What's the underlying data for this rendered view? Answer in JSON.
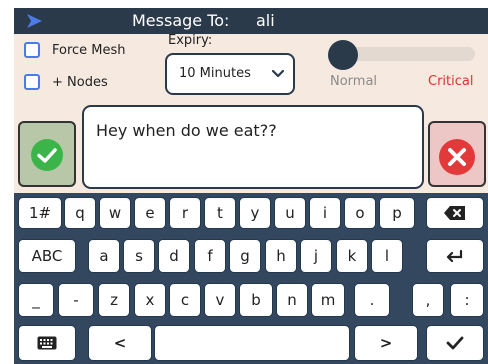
{
  "header": {
    "title_label": "Message To:",
    "recipient": "ali",
    "arrow_icon": "send-arrow-icon",
    "bg_color": "#2b3a4b",
    "arrow_color": "#4a7be8"
  },
  "options": {
    "force_mesh_label": "Force Mesh",
    "nodes_label": "+ Nodes",
    "force_mesh_checked": false,
    "nodes_checked": false,
    "expiry_label": "Expiry:",
    "expiry_value": "10 Minutes",
    "priority_low_label": "Normal",
    "priority_high_label": "Critical",
    "priority_level": 0
  },
  "compose": {
    "message_text": "Hey when do we eat??",
    "send_icon": "check-icon",
    "cancel_icon": "close-icon",
    "send_color": "#3bb54a",
    "cancel_color": "#e23a3a"
  },
  "keyboard": {
    "row1": [
      "1#",
      "q",
      "w",
      "e",
      "r",
      "t",
      "y",
      "u",
      "i",
      "o",
      "p"
    ],
    "row2": [
      "ABC",
      "a",
      "s",
      "d",
      "f",
      "g",
      "h",
      "j",
      "k",
      "l"
    ],
    "row3": [
      "_",
      "-",
      "z",
      "x",
      "c",
      "v",
      "b",
      "n",
      "m",
      ".",
      ",",
      ":"
    ],
    "backspace_icon": "backspace-icon",
    "enter_icon": "enter-icon",
    "keyboard_icon": "keyboard-icon",
    "left_label": "<",
    "right_label": ">",
    "ok_icon": "checkmark-icon"
  }
}
